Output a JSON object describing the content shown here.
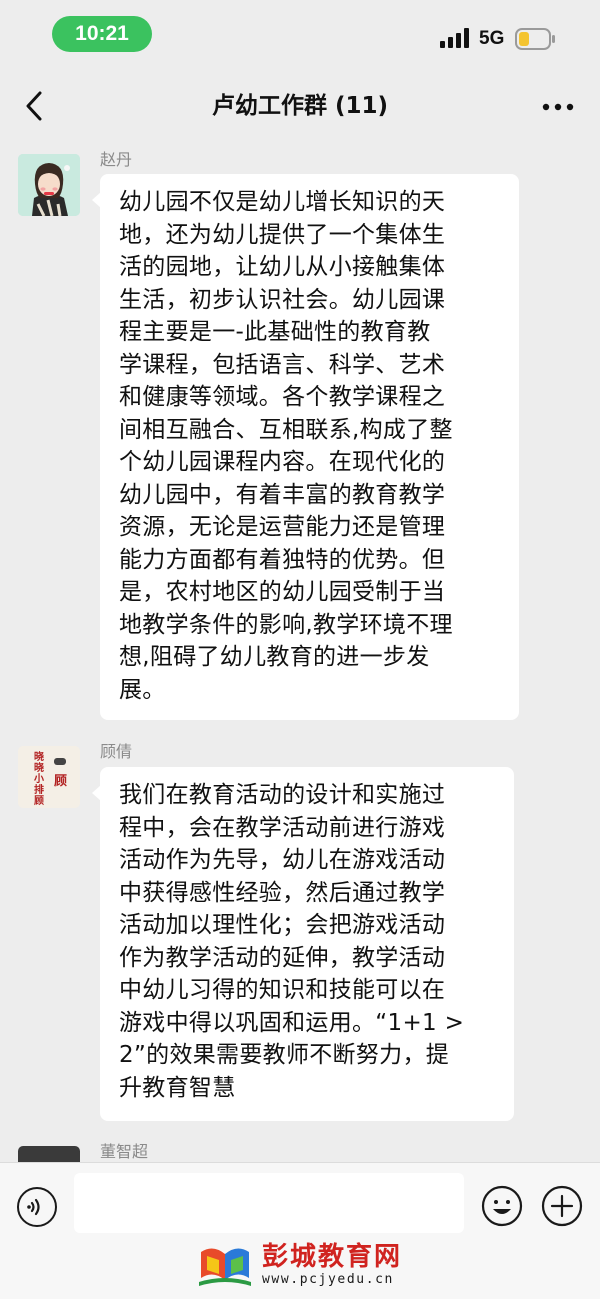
{
  "status_bar": {
    "time": "10:21",
    "network": "5G"
  },
  "header": {
    "title": "卢幼工作群 (11)"
  },
  "messages": [
    {
      "sender": "赵丹",
      "lines": [
        "幼儿园不仅是幼儿增长知识的天",
        "地，还为幼儿提供了一个集体生",
        "活的园地，让幼儿从小接触集体",
        "生活，初步认识社会。幼儿园课",
        "程主要是一-此基础性的教育教",
        "学课程，包括语言、科学、艺术",
        "和健康等领域。各个教学课程之",
        "间相互融合、互相联系,构成了整",
        "个幼儿园课程内容。在现代化的",
        "幼儿园中，有着丰富的教育教学",
        "资源，无论是运营能力还是管理",
        "能力方面都有着独特的优势。但",
        "是，农村地区的幼儿园受制于当",
        "地教学条件的影响,教学环境不理",
        "想,阻碍了幼儿教育的进一步发",
        "展。"
      ]
    },
    {
      "sender": "顾倩",
      "avatar_text": {
        "left_column": "晓晓小排顾",
        "right_column": "顾"
      },
      "lines": [
        "我们在教育活动的设计和实施过",
        "程中，会在教学活动前进行游戏",
        "活动作为先导，幼儿在游戏活动",
        "中获得感性经验，然后通过教学",
        "活动加以理性化；会把游戏活动",
        "作为教学活动的延伸，教学活动",
        "中幼儿习得的知识和技能可以在",
        "游戏中得以巩固和运用。“1+1 >",
        "2”的效果需要教师不断努力，提",
        "升教育智慧"
      ]
    },
    {
      "sender": "董智超"
    }
  ],
  "input_bar": {
    "value": "",
    "placeholder": ""
  },
  "watermark": {
    "title": "彭城教育网",
    "url": "www.pcjyedu.cn"
  },
  "colors": {
    "time_pill": "#3bc25f",
    "background": "#ededed",
    "bubble": "#ffffff",
    "watermark_red": "#d0231f"
  }
}
